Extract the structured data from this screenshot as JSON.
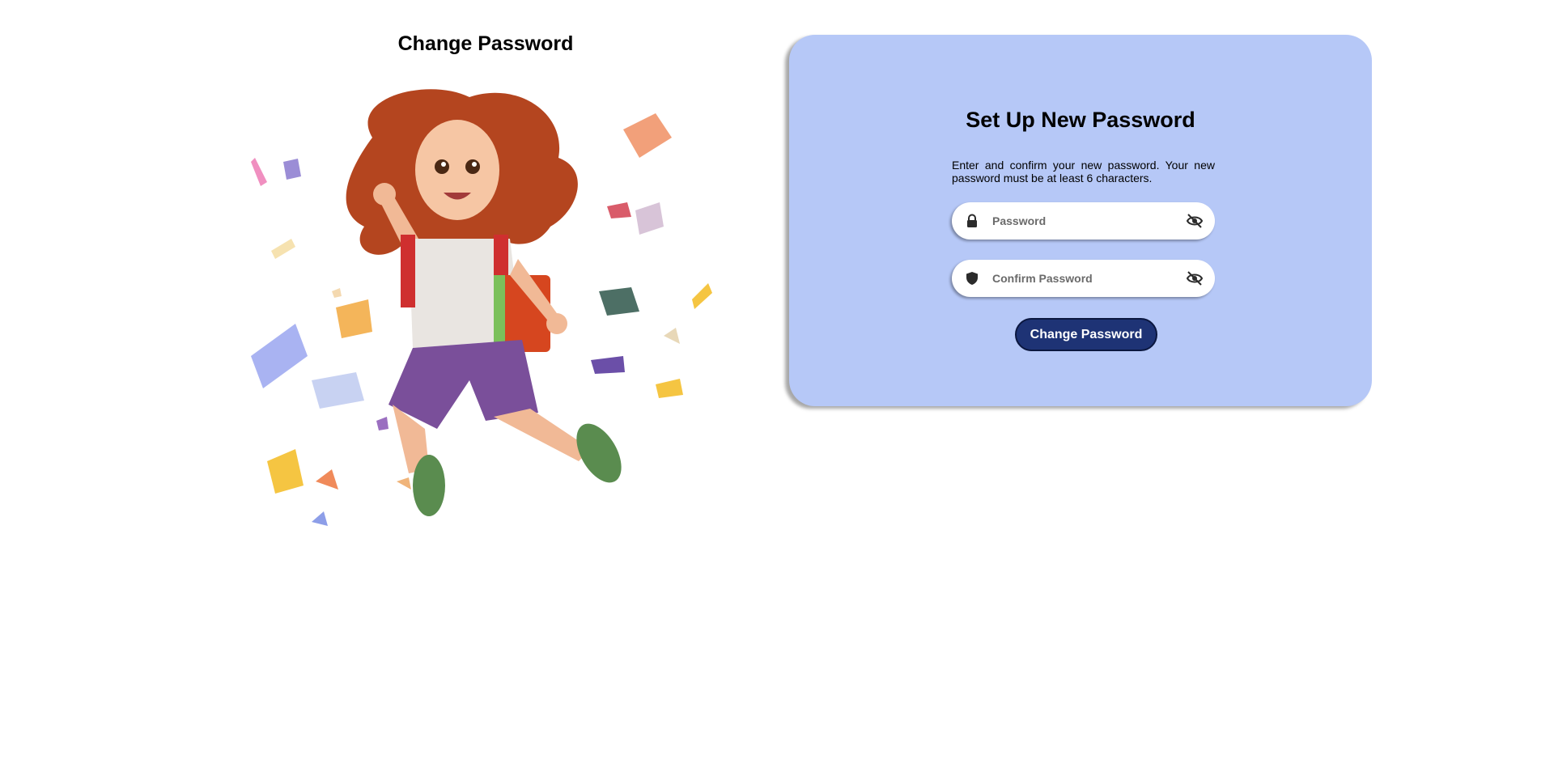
{
  "left": {
    "title": "Change Password"
  },
  "card": {
    "title": "Set Up New Password",
    "description": "Enter and confirm your new password. Your new password must be at least 6 characters.",
    "password_field": {
      "placeholder": "Password",
      "value": "",
      "icon": "lock-icon",
      "toggle_icon": "eye-slash-icon"
    },
    "confirm_field": {
      "placeholder": "Confirm Password",
      "value": "",
      "icon": "shield-icon",
      "toggle_icon": "eye-slash-icon"
    },
    "submit_label": "Change Password"
  },
  "colors": {
    "card_bg": "#b6c8f7",
    "button_bg": "#1e3375",
    "button_text": "#ffffff"
  }
}
